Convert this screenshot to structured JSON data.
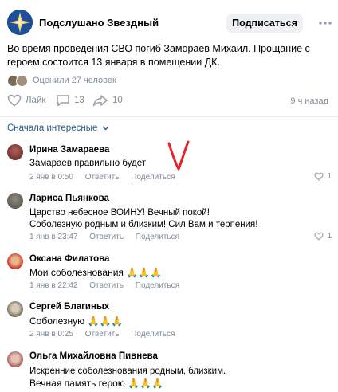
{
  "post": {
    "group_name": "Подслушано Звездный",
    "subscribe_label": "Подписаться",
    "text": "Во время проведения СВО погиб Замораев Михаил. Прощание с героем состоится 13 января в помещении ДК.",
    "likes_text": "Оценили 27 человек",
    "like_label": "Лайк",
    "comments_count": "13",
    "shares_count": "10",
    "time_ago": "9 ч назад"
  },
  "sort_label": "Сначала интересные",
  "comments": [
    {
      "author": "Ирина Замараева",
      "text": "Замараев правильно будет",
      "time": "2 янв в 0:50",
      "reply": "Ответить",
      "share": "Поделиться",
      "likes": "1"
    },
    {
      "author": "Лариса Пьянкова",
      "text": "Царство небесное ВОИНУ! Вечный покой!",
      "text2": "Соболезную родным и близким! Сил Вам и терпения!",
      "time": "1 янв в 23:47",
      "reply": "Ответить",
      "share": "Поделиться",
      "likes": "1"
    },
    {
      "author": "Оксана Филатова",
      "text": "Мои соболезнования 🙏🙏🙏",
      "time": "1 янв в 22:42",
      "reply": "Ответить",
      "share": "Поделиться"
    },
    {
      "author": "Сергей Благиных",
      "text": "Соболезную 🙏🙏🙏",
      "time": "2 янв в 0:25",
      "reply": "Ответить",
      "share": "Поделиться"
    },
    {
      "author": "Ольга Михайловна Пивнева",
      "text": "Искренние соболезнования родным, близким.",
      "text2": "Вечная память герою 🙏🙏🙏"
    }
  ],
  "colors": {
    "link": "#2a5885",
    "muted": "#818c99",
    "button_bg": "#eef0f3",
    "annotation": "#e8212a"
  }
}
